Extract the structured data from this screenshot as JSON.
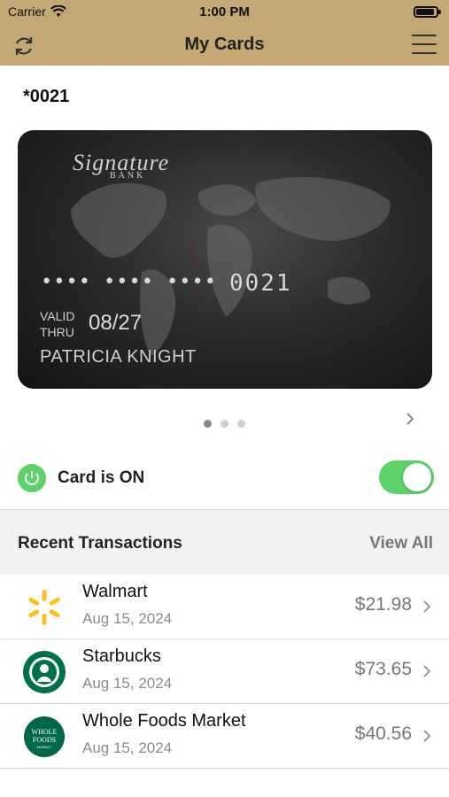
{
  "status_bar": {
    "carrier": "Carrier",
    "time": "1:00 PM"
  },
  "nav": {
    "title": "My Cards"
  },
  "card": {
    "masked_number": "*0021",
    "bank_logo": "Signature",
    "bank_logo_sub": "BANK",
    "number_dots": [
      "••••",
      "••••",
      "••••"
    ],
    "last4": "0021",
    "valid_label_1": "VALID",
    "valid_label_2": "THRU",
    "expiry": "08/27",
    "holder": "PATRICIA KNIGHT"
  },
  "card_status": {
    "label": "Card is ON",
    "enabled": true
  },
  "transactions_header": {
    "title": "Recent Transactions",
    "view_all": "View All"
  },
  "transactions": [
    {
      "merchant": "Walmart",
      "date": "Aug 15, 2024",
      "amount": "$21.98",
      "icon": "walmart-logo"
    },
    {
      "merchant": "Starbucks",
      "date": "Aug 15, 2024",
      "amount": "$73.65",
      "icon": "starbucks-logo"
    },
    {
      "merchant": "Whole Foods Market",
      "date": "Aug 15, 2024",
      "amount": "$40.56",
      "icon": "whole-foods-logo",
      "logo_text_1": "WHOLE",
      "logo_text_2": "FOODS",
      "logo_text_3": "MARKET"
    }
  ],
  "colors": {
    "header_gold": "#c3a876",
    "toggle_green": "#5dd16a"
  }
}
